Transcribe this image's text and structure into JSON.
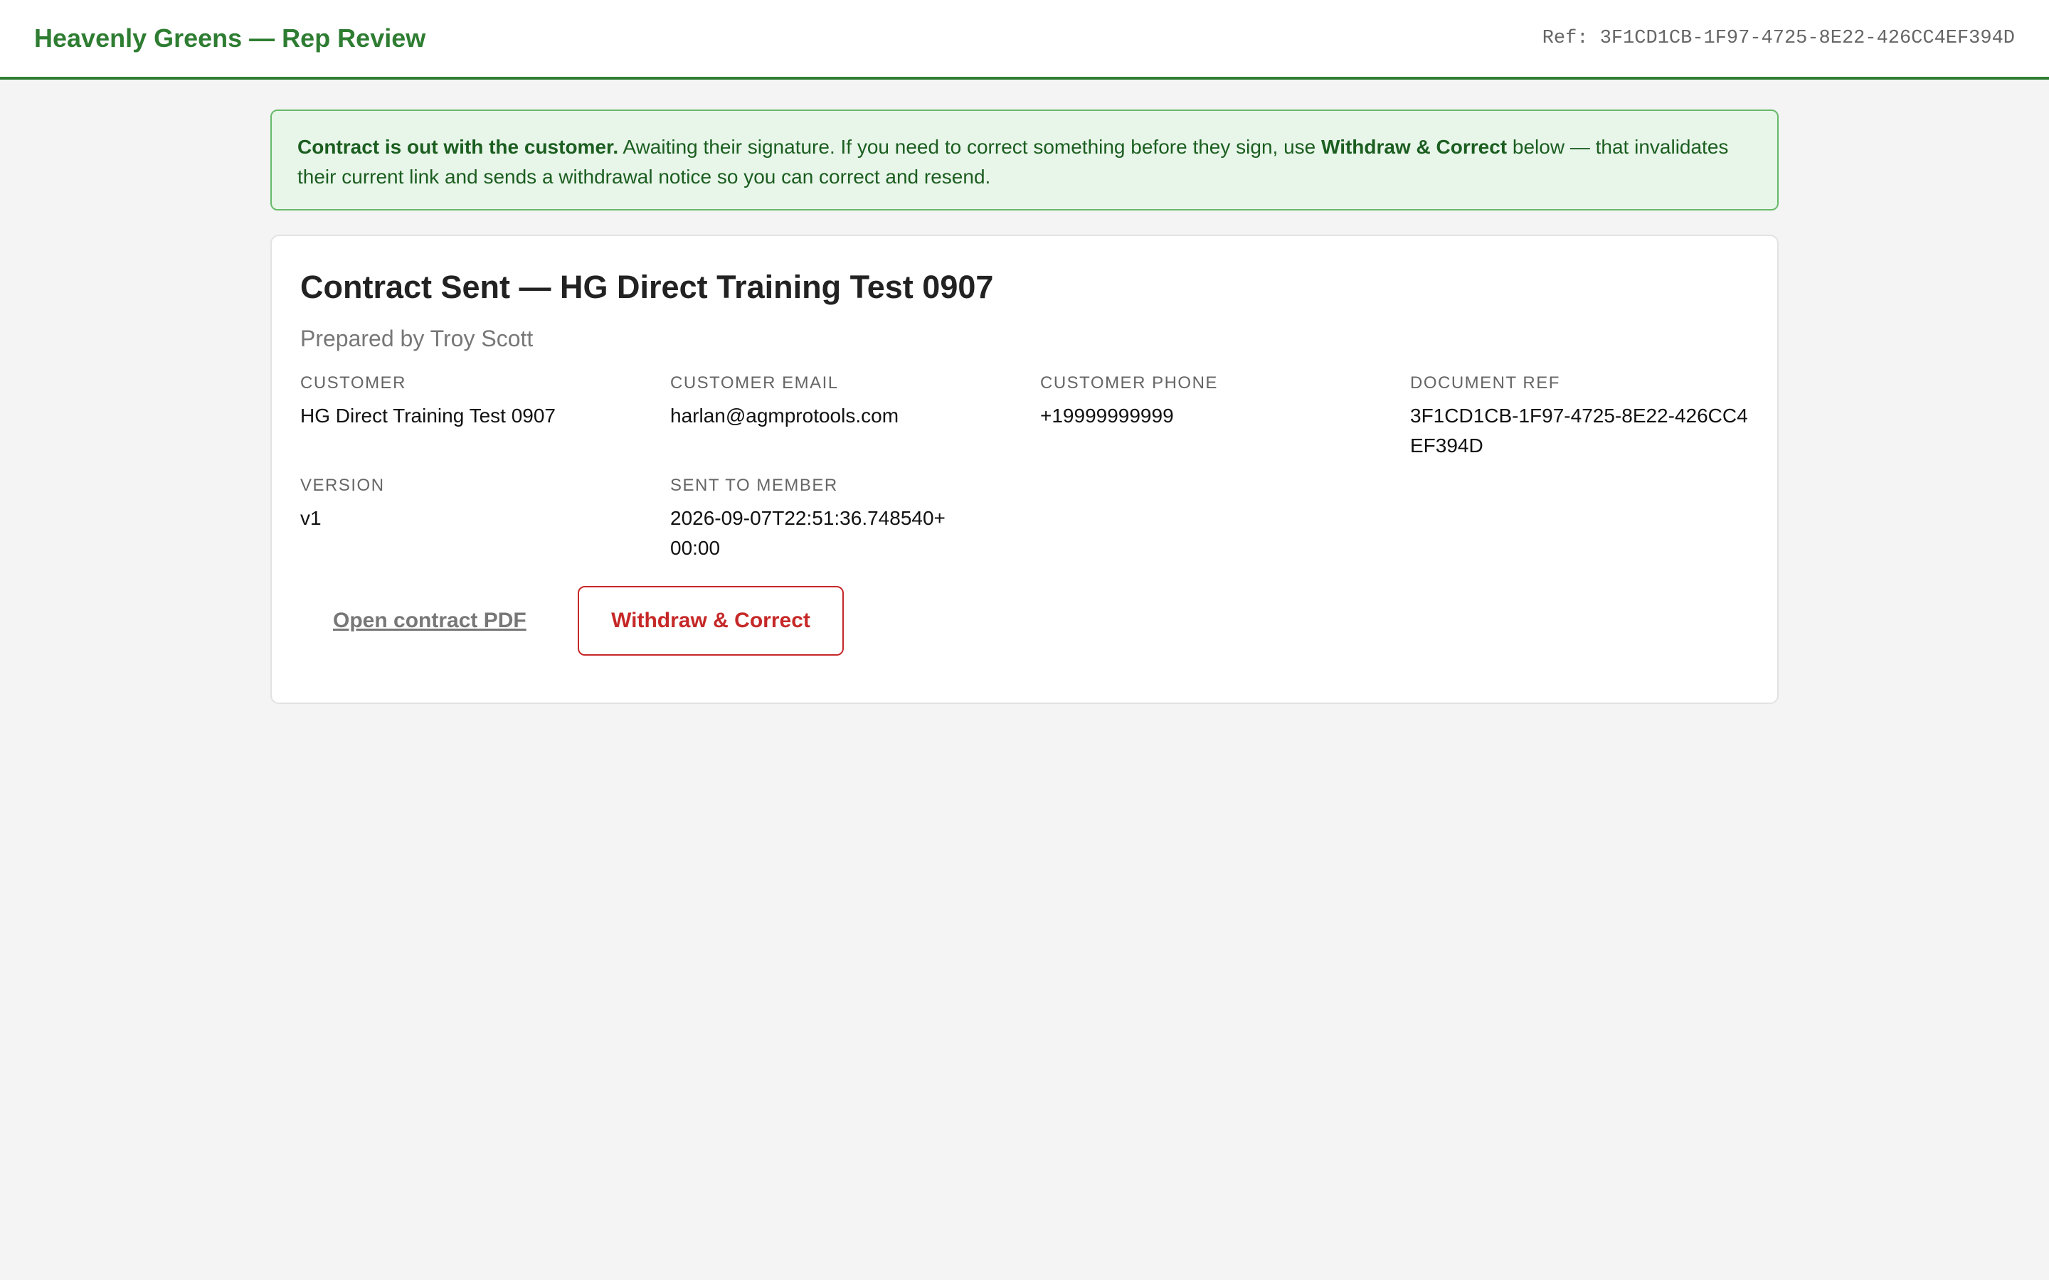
{
  "header": {
    "title": "Heavenly Greens — Rep Review",
    "ref_text": "Ref: 3F1CD1CB-1F97-4725-8E22-426CC4EF394D"
  },
  "notice": {
    "bold_lead": "Contract is out with the customer.",
    "text_1": " Awaiting their signature. If you need to correct something before they sign, use ",
    "bold_action": "Withdraw & Correct",
    "text_2": " below — that invalidates their current link and sends a withdrawal notice so you can correct and resend."
  },
  "card": {
    "title": "Contract Sent — HG Direct Training Test 0907",
    "subtitle": "Prepared by Troy Scott",
    "fields": {
      "customer": {
        "label": "CUSTOMER",
        "value": "HG Direct Training Test 0907"
      },
      "customer_email": {
        "label": "CUSTOMER EMAIL",
        "value": "harlan@agmprotools.com"
      },
      "customer_phone": {
        "label": "CUSTOMER PHONE",
        "value": "+19999999999"
      },
      "document_ref": {
        "label": "DOCUMENT REF",
        "value": "3F1CD1CB-1F97-4725-8E22-426CC4EF394D"
      },
      "version": {
        "label": "VERSION",
        "value": "v1"
      },
      "sent_to_member": {
        "label": "SENT TO MEMBER",
        "value": "2026-09-07T22:51:36.748540+00:00"
      }
    },
    "actions": {
      "open_pdf_label": "Open contract PDF",
      "withdraw_label": "Withdraw & Correct"
    }
  },
  "colors": {
    "brand_green": "#2e7d32",
    "notice_bg": "#e8f5e9",
    "notice_text": "#1b5e20",
    "danger_red": "#c62828",
    "page_bg": "#f4f4f4"
  }
}
